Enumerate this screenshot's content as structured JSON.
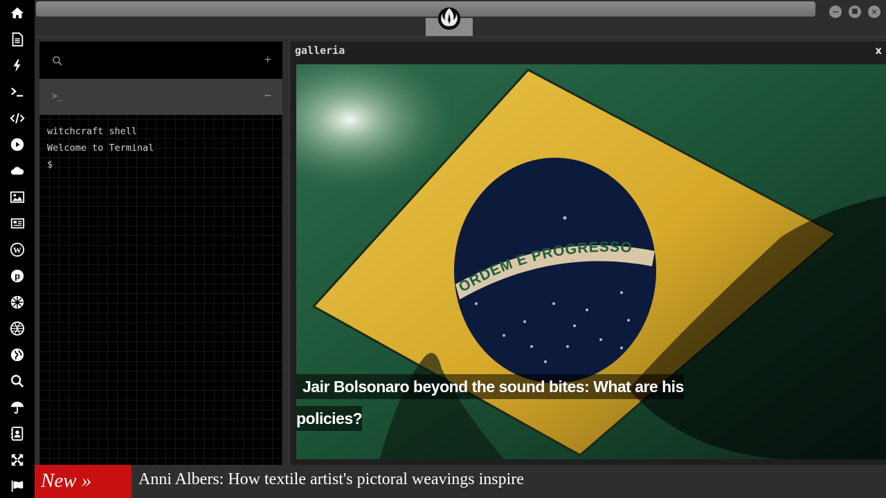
{
  "sidebar": {
    "items": [
      {
        "icon": "home-icon"
      },
      {
        "icon": "document-icon"
      },
      {
        "icon": "lightning-icon"
      },
      {
        "icon": "terminal-icon"
      },
      {
        "icon": "code-icon"
      },
      {
        "icon": "play-icon"
      },
      {
        "icon": "cloud-icon"
      },
      {
        "icon": "image-icon"
      },
      {
        "icon": "newspaper-icon"
      },
      {
        "icon": "wordpress-icon"
      },
      {
        "icon": "pinterest-icon"
      },
      {
        "icon": "galactic-empire-icon"
      },
      {
        "icon": "network-globe-icon"
      },
      {
        "icon": "globe-icon"
      },
      {
        "icon": "search-icon"
      },
      {
        "icon": "umbrella-icon"
      },
      {
        "icon": "contact-book-icon"
      },
      {
        "icon": "expand-arrows-icon"
      },
      {
        "icon": "flag-icon"
      }
    ]
  },
  "topbar": {
    "logo_icon": "rebel-alliance-icon",
    "window_buttons": {
      "minimize": "−",
      "maximize": "■",
      "close": "✕"
    }
  },
  "terminal": {
    "search_icon": "search-icon",
    "add_label": "+",
    "prompt_symbol": ">_",
    "collapse_label": "−",
    "lines": [
      "witchcraft shell",
      "Welcome to Terminal",
      "$"
    ]
  },
  "galleria": {
    "title": "galleria",
    "close_label": "x",
    "caption_line1": "Jair Bolsonaro beyond the sound bites: What are his",
    "caption_line2": "policies?",
    "flag_motto": "ORDEM E PROGRESSO"
  },
  "ticker": {
    "badge": "New »",
    "headline": "Anni Albers: How textile artist's pictoral weavings inspire"
  },
  "colors": {
    "sidebar_bg": "#000000",
    "panel_bg": "#2e2e2e",
    "ticker_badge": "#c81010",
    "flag_green": "#1f5b3b",
    "flag_yellow": "#e0b52c",
    "flag_blue": "#0c1a3c"
  }
}
